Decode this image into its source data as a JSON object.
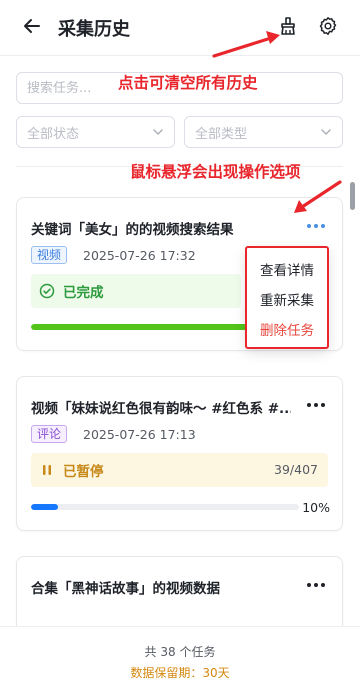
{
  "header": {
    "title": "采集历史",
    "back_icon": "arrow-left-icon",
    "clear_icon": "broom-icon",
    "settings_icon": "gear-icon"
  },
  "filters": {
    "search_placeholder": "搜索任务...",
    "status_value": "全部状态",
    "type_value": "全部类型"
  },
  "annotations": {
    "clear_hint": "点击可清空所有历史",
    "hover_hint": "鼠标悬浮会出现操作选项",
    "color": "#e8262c"
  },
  "tasks": [
    {
      "title": "关键词「美女」的的视频搜索结果",
      "tag": "视频",
      "time": "2025-07-26 17:32",
      "status": "已完成",
      "progress": 1.0
    },
    {
      "title": "视频「妹妹说红色很有韵味～ #红色系 #...",
      "tag": "评论",
      "time": "2025-07-26 17:13",
      "status": "已暂停",
      "count": "39/407",
      "progress_label": "10%",
      "progress": 0.1
    },
    {
      "title": "合集「黑神话故事」的视频数据"
    }
  ],
  "menu": {
    "items": [
      "查看详情",
      "重新采集",
      "删除任务"
    ]
  },
  "footer": {
    "total": "共 38 个任务",
    "retention": "数据保留期：30天"
  },
  "colors": {
    "success": "#52c41a",
    "primary": "#1677ff",
    "warning": "#c8891a",
    "danger": "#e8463b"
  }
}
